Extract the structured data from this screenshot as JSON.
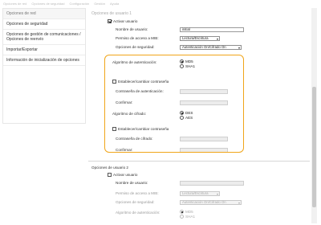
{
  "topnav": [
    "Opciones de red",
    "Opciones de seguridad",
    "Configuración",
    "Gestión",
    "Ayuda"
  ],
  "sidebar": {
    "items": [
      {
        "label": "Opciones de red"
      },
      {
        "label": "Opciones de seguridad"
      },
      {
        "label": "Opciones de gestión de comunicaciones / Opciones de reenvío"
      },
      {
        "label": "Importar/Exportar"
      },
      {
        "label": "Información de inicialización de opciones"
      }
    ]
  },
  "user1": {
    "section_title": "Opciones de usuario 1",
    "enable_label": "Activar usuario",
    "username_label": "Nombre de usuario:",
    "username_value": "initial",
    "mib_label": "Permiso de acceso a MIB:",
    "mib_value": "Lectura/Escritura",
    "security_label": "Opciones de seguridad:",
    "security_value": "Autenticación On/Cifrado On",
    "auth_algo_label": "Algoritmo de autenticación:",
    "auth_opts": [
      "MD5",
      "SHA1"
    ],
    "set_change_pwd_label": "Establecer/cambiar contraseña",
    "auth_pwd_label": "Contraseña de autenticación:",
    "confirm_label": "Confirmar:",
    "enc_algo_label": "Algoritmo de cifrado:",
    "enc_opts": [
      "DES",
      "AES"
    ],
    "set_change_pwd2_label": "Establecer/cambiar contraseña",
    "enc_pwd_label": "Contraseña de cifrado:",
    "confirm2_label": "Confirmar:"
  },
  "user2": {
    "section_title": "Opciones de usuario 2",
    "enable_label": "Activar usuario",
    "username_label": "Nombre de usuario:",
    "mib_label": "Permiso de acceso a MIB:",
    "mib_value": "Lectura/Escritura",
    "security_label": "Opciones de seguridad:",
    "security_value": "Autenticación On/Cifrado On",
    "auth_algo_label": "Algoritmo de autenticación:",
    "auth_opts": [
      "MD5",
      "SHA1"
    ]
  },
  "icons": [
    "chevron-down-icon"
  ],
  "colors": {
    "highlight": "#f0a51a"
  }
}
